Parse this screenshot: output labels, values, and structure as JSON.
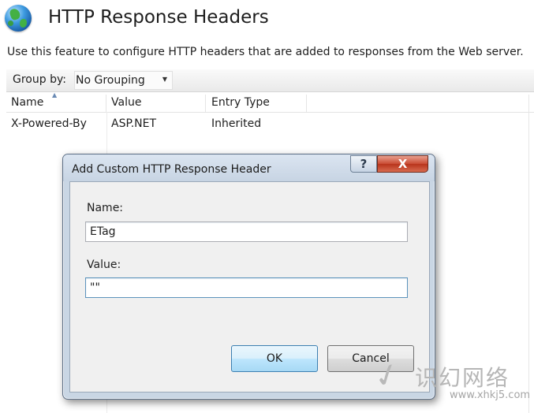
{
  "header": {
    "title": "HTTP Response Headers",
    "description": "Use this feature to configure HTTP headers that are added to responses from the Web server."
  },
  "toolbar": {
    "group_by_label": "Group by:",
    "group_by_value": "No Grouping"
  },
  "table": {
    "columns": [
      "Name",
      "Value",
      "Entry Type"
    ],
    "rows": [
      {
        "name": "X-Powered-By",
        "value": "ASP.NET",
        "entry_type": "Inherited"
      }
    ]
  },
  "dialog": {
    "title": "Add Custom HTTP Response Header",
    "help_label": "?",
    "close_label": "X",
    "name_label": "Name:",
    "name_value": "ETag",
    "value_label": "Value:",
    "value_value": "\"\"",
    "ok_label": "OK",
    "cancel_label": "Cancel"
  },
  "watermark": {
    "chars": "识幻网络",
    "url": "www.xhkj5.com"
  },
  "colors": {
    "accent": "#3c7fb1",
    "close_red": "#c94a32",
    "dialog_frame": "#c9d6e4"
  }
}
